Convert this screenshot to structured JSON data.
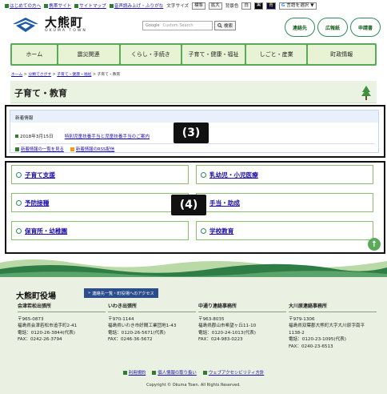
{
  "utility": {
    "links": [
      "はじめての方へ",
      "携帯サイト",
      "サイトマップ",
      "音声読み上げ・ふりがな"
    ],
    "text_size_label": "文字サイズ",
    "text_size_options": [
      "標準",
      "拡大"
    ],
    "bg_color_label": "背景色",
    "bg_options": [
      "白",
      "黒",
      "青"
    ],
    "translate_label": "言語を選択"
  },
  "header": {
    "logo_main": "大熊町",
    "logo_sub": "OKUMA TOWN",
    "search_placeholder": "Custom Search",
    "search_logo": "Google",
    "search_button": "検索",
    "pills": [
      "連絡先",
      "広報紙",
      "申請書"
    ]
  },
  "nav": [
    "ホーム",
    "震災関連",
    "くらし・手続き",
    "子育て・健康・福祉",
    "しごと・産業",
    "町政情報"
  ],
  "breadcrumb": {
    "links": [
      "ホーム",
      "分類でさがす",
      "子育て・健康・福祉"
    ],
    "current": "子育て・教育",
    "sep": ">"
  },
  "page_title": "子育て・教育",
  "news": {
    "heading": "新着情報",
    "items": [
      {
        "date": "2018年3月15日",
        "title": "特別児童扶養手当と児童扶養手当のご案内"
      }
    ],
    "list_link": "新着情報の一覧を見る",
    "rss_link": "新着情報のRSS配信"
  },
  "tags": {
    "box3": "(3)",
    "box4": "(4)"
  },
  "categories": [
    "子育て支援",
    "乳幼児・小児医療",
    "予防接種",
    "手当・助成",
    "保育所・幼稚園",
    "学校教育"
  ],
  "footer": {
    "office": "大熊町役場",
    "access_button": "連絡先一覧・町役場へのアクセス",
    "offices": [
      {
        "name": "会津若松出張所",
        "zip": "〒965-0873",
        "addr": "福島県会津若松市追手町2-41",
        "tel": "電話：0120-26-3844(代表)",
        "fax": "FAX：0242-26-3794"
      },
      {
        "name": "いわき出張所",
        "zip": "〒970-1144",
        "addr": "福島県いわき市好間工業団地1-43",
        "tel": "電話：0120-26-5671(代表)",
        "fax": "FAX：0246-36-5672"
      },
      {
        "name": "中通り連絡事務所",
        "zip": "〒963-8035",
        "addr": "福島県郡山市希望ヶ丘11-10",
        "tel": "電話：0120-24-1013(代表)",
        "fax": "FAX：024-983-0223"
      },
      {
        "name": "大川原連絡事務所",
        "zip": "〒979-1306",
        "addr": "福島県双葉郡大熊町大字大川原字南平1138-2",
        "tel": "電話：0120-23-1095(代表)",
        "fax": "FAX：0240-23-6513"
      }
    ],
    "links": [
      "利用規約",
      "個人情報の取り扱い",
      "ウェブアクセシビリティ方針"
    ],
    "copyright": "Copyright © Okuma Town. All Rights Reserved."
  }
}
